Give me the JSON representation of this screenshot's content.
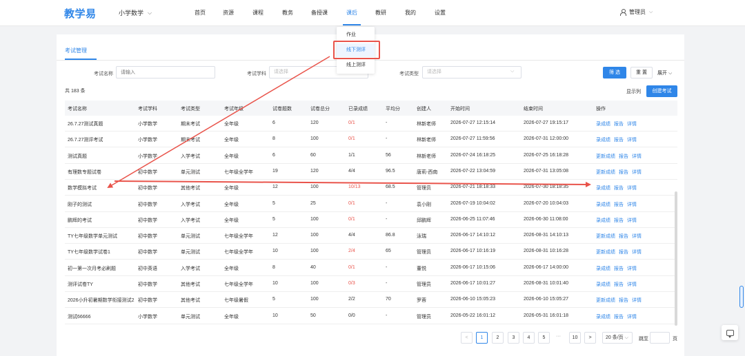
{
  "app": {
    "logo": "教学易",
    "subject": "小学数学"
  },
  "nav": {
    "items": [
      "首页",
      "资源",
      "课程",
      "教务",
      "备授课",
      "课后",
      "教研",
      "我的",
      "设置"
    ],
    "active": "课后"
  },
  "user": {
    "name": "管理员"
  },
  "dropdown": {
    "items": [
      "作业",
      "线下测评",
      "线上测评"
    ],
    "selected": "线下测评"
  },
  "tab": {
    "label": "考试管理"
  },
  "filters": {
    "name_label": "考试名称",
    "name_placeholder": "请输入",
    "subject_label": "考试学科",
    "subject_placeholder": "请选择",
    "type_label": "考试类型",
    "type_placeholder": "请选择",
    "filter_button": "筛 选",
    "reset_button": "重 置",
    "expand_label": "展开"
  },
  "list": {
    "total": "共 183 条",
    "show_columns": "显示列",
    "create_button": "创建考试"
  },
  "table": {
    "headers": [
      "考试名称",
      "考试学科",
      "考试类型",
      "考试年级",
      "试卷题数",
      "试卷总分",
      "已录成绩",
      "平均分",
      "创建人",
      "开始时间",
      "结束时间",
      "操作"
    ],
    "rows": [
      {
        "name": "26.7.27测试真题",
        "subject": "小学数学",
        "type": "期末考试",
        "grade": "全年级",
        "questions": "6",
        "score": "120",
        "entered": "0/1",
        "entered_red": true,
        "avg": "-",
        "creator": "林新老师",
        "start": "2026-07-27 12:15:14",
        "end": "2026-07-27 19:15:17",
        "op1": "录成绩",
        "op2": "报告",
        "op3": "详情"
      },
      {
        "name": "26.7.27测评考试",
        "subject": "小学数学",
        "type": "期末考试",
        "grade": "全年级",
        "questions": "8",
        "score": "100",
        "entered": "0/1",
        "entered_red": true,
        "avg": "-",
        "creator": "林新老师",
        "start": "2026-07-27 11:59:56",
        "end": "2026-07-31 12:00:00",
        "op1": "录成绩",
        "op2": "报告",
        "op3": "详情"
      },
      {
        "name": "测试真题",
        "subject": "小学数学",
        "type": "入学考试",
        "grade": "全年级",
        "questions": "6",
        "score": "60",
        "entered": "1/1",
        "entered_red": false,
        "avg": "56",
        "creator": "林新老师",
        "start": "2026-07-24 16:18:25",
        "end": "2026-07-25 16:18:28",
        "op1": "更新成绩",
        "op2": "报告",
        "op3": "详情"
      },
      {
        "name": "有理数专题试卷",
        "subject": "初中数学",
        "type": "单元测试",
        "grade": "七年级全学年",
        "questions": "19",
        "score": "120",
        "entered": "4/4",
        "entered_red": false,
        "avg": "96.5",
        "creator": "唐莉-西南",
        "start": "2026-07-22 13:04:59",
        "end": "2026-07-31 13:05:08",
        "op1": "更新成绩",
        "op2": "报告",
        "op3": "详情"
      },
      {
        "name": "数学模拟考试",
        "subject": "初中数学",
        "type": "其他考试",
        "grade": "全年级",
        "questions": "12",
        "score": "100",
        "entered": "10/13",
        "entered_red": true,
        "avg": "68.5",
        "creator": "管理员",
        "start": "2026-07-21 18:18:33",
        "end": "2026-07-30 18:18:35",
        "op1": "录成绩",
        "op2": "报告",
        "op3": "详情"
      },
      {
        "name": "刚子的测试",
        "subject": "初中数学",
        "type": "入学考试",
        "grade": "全年级",
        "questions": "5",
        "score": "25",
        "entered": "0/1",
        "entered_red": true,
        "avg": "-",
        "creator": "袁小刚",
        "start": "2026-07-19 10:04:02",
        "end": "2026-07-20 10:04:03",
        "op1": "录成绩",
        "op2": "报告",
        "op3": "详情"
      },
      {
        "name": "鹏辉的考试",
        "subject": "初中数学",
        "type": "入学考试",
        "grade": "全年级",
        "questions": "5",
        "score": "100",
        "entered": "0/1",
        "entered_red": true,
        "avg": "-",
        "creator": "邱鹏辉",
        "start": "2026-06-25 11:07:46",
        "end": "2026-06-30 11:08:00",
        "op1": "录成绩",
        "op2": "报告",
        "op3": "详情"
      },
      {
        "name": "TY七年级数学单元测试",
        "subject": "初中数学",
        "type": "单元测试",
        "grade": "七年级全学年",
        "questions": "12",
        "score": "100",
        "entered": "4/4",
        "entered_red": false,
        "avg": "86.8",
        "creator": "泳瑞",
        "start": "2026-06-17 14:10:12",
        "end": "2026-08-31 14:10:13",
        "op1": "更新成绩",
        "op2": "报告",
        "op3": "详情"
      },
      {
        "name": "TY七年级数学试卷1",
        "subject": "初中数学",
        "type": "单元测试",
        "grade": "七年级全学年",
        "questions": "10",
        "score": "100",
        "entered": "2/4",
        "entered_red": true,
        "avg": "65",
        "creator": "管理员",
        "start": "2026-06-17 10:16:19",
        "end": "2026-08-31 10:16:28",
        "op1": "更新成绩",
        "op2": "报告",
        "op3": "详情"
      },
      {
        "name": "初一第一次月考必刷题",
        "subject": "初中英语",
        "type": "入学考试",
        "grade": "全年级",
        "questions": "8",
        "score": "40",
        "entered": "0/1",
        "entered_red": true,
        "avg": "-",
        "creator": "董悦",
        "start": "2026-06-17 10:15:06",
        "end": "2026-06-17 14:00:00",
        "op1": "录成绩",
        "op2": "报告",
        "op3": "详情"
      },
      {
        "name": "测评试卷TY",
        "subject": "初中数学",
        "type": "其他考试",
        "grade": "七年级全学年",
        "questions": "10",
        "score": "100",
        "entered": "0/3",
        "entered_red": true,
        "avg": "-",
        "creator": "管理员",
        "start": "2026-06-17 10:01:27",
        "end": "2026-08-31 10:01:40",
        "op1": "录成绩",
        "op2": "报告",
        "op3": "详情"
      },
      {
        "name": "2026小升初暑期数学衔接测试2",
        "subject": "初中数学",
        "type": "其他考试",
        "grade": "七年级暑假",
        "questions": "5",
        "score": "100",
        "entered": "2/2",
        "entered_red": false,
        "avg": "70",
        "creator": "罗蓉",
        "start": "2026-06-10 15:05:23",
        "end": "2026-06-10 15:05:27",
        "op1": "更新成绩",
        "op2": "报告",
        "op3": "详情"
      },
      {
        "name": "测试66666",
        "subject": "小学数学",
        "type": "单元测试",
        "grade": "全年级",
        "questions": "10",
        "score": "50",
        "entered": "0/0",
        "entered_red": false,
        "avg": "-",
        "creator": "管理员",
        "start": "2026-05-22 16:01:12",
        "end": "2026-05-31 16:01:18",
        "op1": "录成绩",
        "op2": "报告",
        "op3": "详情"
      }
    ]
  },
  "pagination": {
    "prev": "<",
    "pages": [
      "1",
      "2",
      "3",
      "4",
      "5"
    ],
    "current": "1",
    "ellipsis": "···",
    "last": "10",
    "next": ">",
    "page_size": "20 条/页",
    "jump_label": "跳至",
    "jump_unit": "页"
  },
  "colors": {
    "accent": "#2f86e8",
    "annotation": "#e9534a",
    "danger": "#e9534a"
  }
}
